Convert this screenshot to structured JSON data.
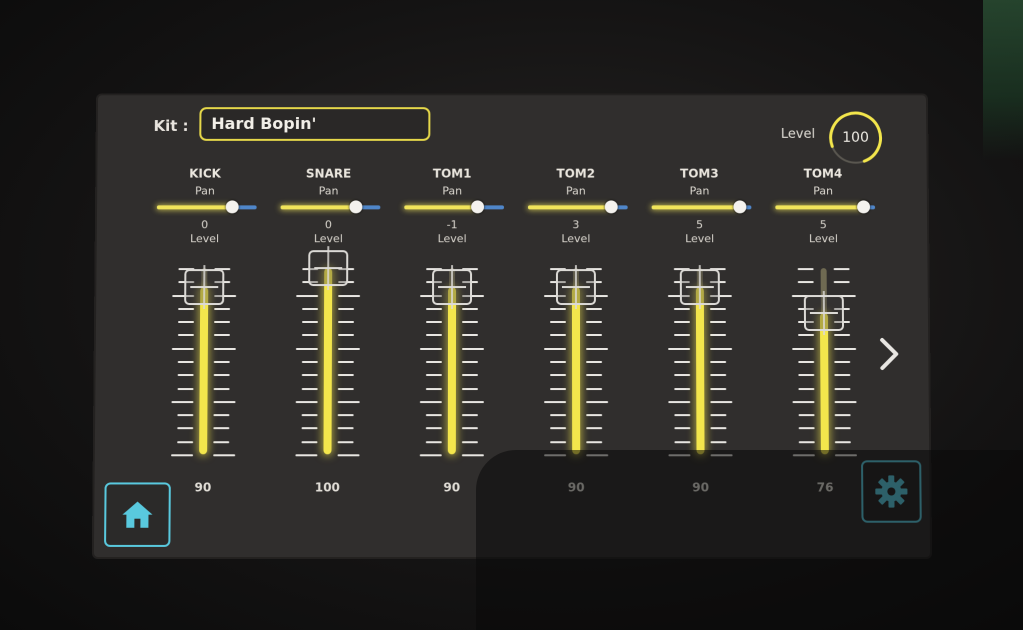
{
  "kit": {
    "label": "Kit :",
    "name": "Hard Bopin'"
  },
  "master": {
    "label": "Level",
    "value": "100",
    "fraction": 1.0
  },
  "channels": [
    {
      "name": "KICK",
      "pan_label": "Pan",
      "pan": 0,
      "pan_text": "0",
      "level_label": "Level",
      "level": 90,
      "level_text": "90"
    },
    {
      "name": "SNARE",
      "pan_label": "Pan",
      "pan": 0,
      "pan_text": "0",
      "level_label": "Level",
      "level": 100,
      "level_text": "100"
    },
    {
      "name": "TOM1",
      "pan_label": "Pan",
      "pan": -1,
      "pan_text": "-1",
      "level_label": "Level",
      "level": 90,
      "level_text": "90"
    },
    {
      "name": "TOM2",
      "pan_label": "Pan",
      "pan": 3,
      "pan_text": "3",
      "level_label": "Level",
      "level": 90,
      "level_text": "90"
    },
    {
      "name": "TOM3",
      "pan_label": "Pan",
      "pan": 5,
      "pan_text": "5",
      "level_label": "Level",
      "level": 90,
      "level_text": "90"
    },
    {
      "name": "TOM4",
      "pan_label": "Pan",
      "pan": 5,
      "pan_text": "5",
      "level_label": "Level",
      "level": 76,
      "level_text": "76"
    }
  ],
  "pan_range": [
    -10,
    10
  ],
  "level_range": [
    0,
    100
  ],
  "colors": {
    "accent_yellow": "#f3e64c",
    "pan_blue": "#4f86c9",
    "button_cyan": "#59c9de"
  },
  "icons": {
    "home": "home-icon",
    "settings": "gear-icon",
    "next": "chevron-right-icon"
  }
}
